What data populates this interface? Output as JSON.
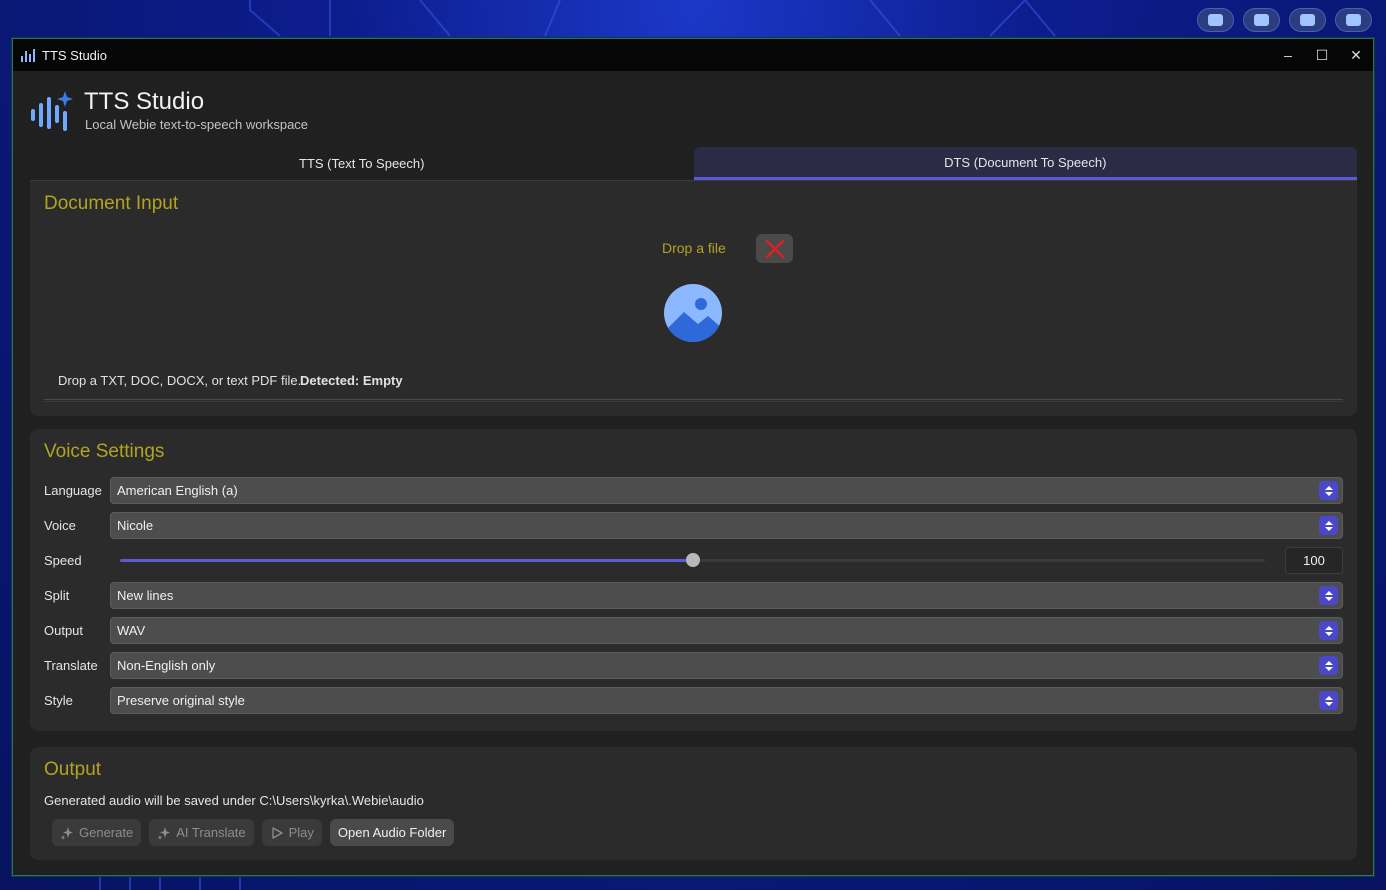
{
  "window": {
    "title": "TTS Studio",
    "controls": {
      "minimize": "–",
      "maximize": "☐",
      "close": "✕"
    }
  },
  "header": {
    "title": "TTS Studio",
    "subtitle": "Local Webie text-to-speech workspace"
  },
  "tabs": [
    {
      "label": "TTS (Text To Speech)",
      "active": false
    },
    {
      "label": "DTS (Document To Speech)",
      "active": true
    }
  ],
  "document_input": {
    "title": "Document Input",
    "drop_label": "Drop a file",
    "hint": "Drop a TXT, DOC, DOCX, or text PDF file.",
    "detected": "Detected: Empty"
  },
  "voice_settings": {
    "title": "Voice Settings",
    "language": {
      "label": "Language",
      "value": "American English (a)"
    },
    "voice": {
      "label": "Voice",
      "value": "Nicole"
    },
    "speed": {
      "label": "Speed",
      "value": "100",
      "slider_fraction": 0.5
    },
    "split": {
      "label": "Split",
      "value": "New lines"
    },
    "output": {
      "label": "Output",
      "value": "WAV"
    },
    "translate": {
      "label": "Translate",
      "value": "Non-English only"
    },
    "style": {
      "label": "Style",
      "value": "Preserve original style"
    }
  },
  "output": {
    "title": "Output",
    "path_text": "Generated audio will be saved under C:\\Users\\kyrka\\.Webie\\audio",
    "buttons": {
      "generate": "Generate",
      "ai_translate": "AI Translate",
      "play": "Play",
      "open_folder": "Open Audio Folder"
    }
  },
  "colors": {
    "accent": "#5b5ad8",
    "section_title": "#b3a322",
    "clear_icon": "#e02020"
  },
  "icons": {
    "app": "audio-waveform-sparkle-icon",
    "clear": "red-x-icon",
    "drop_image": "image-placeholder-icon",
    "generate": "sparkle-icon",
    "translate": "sparkle-icon",
    "play": "play-icon"
  }
}
